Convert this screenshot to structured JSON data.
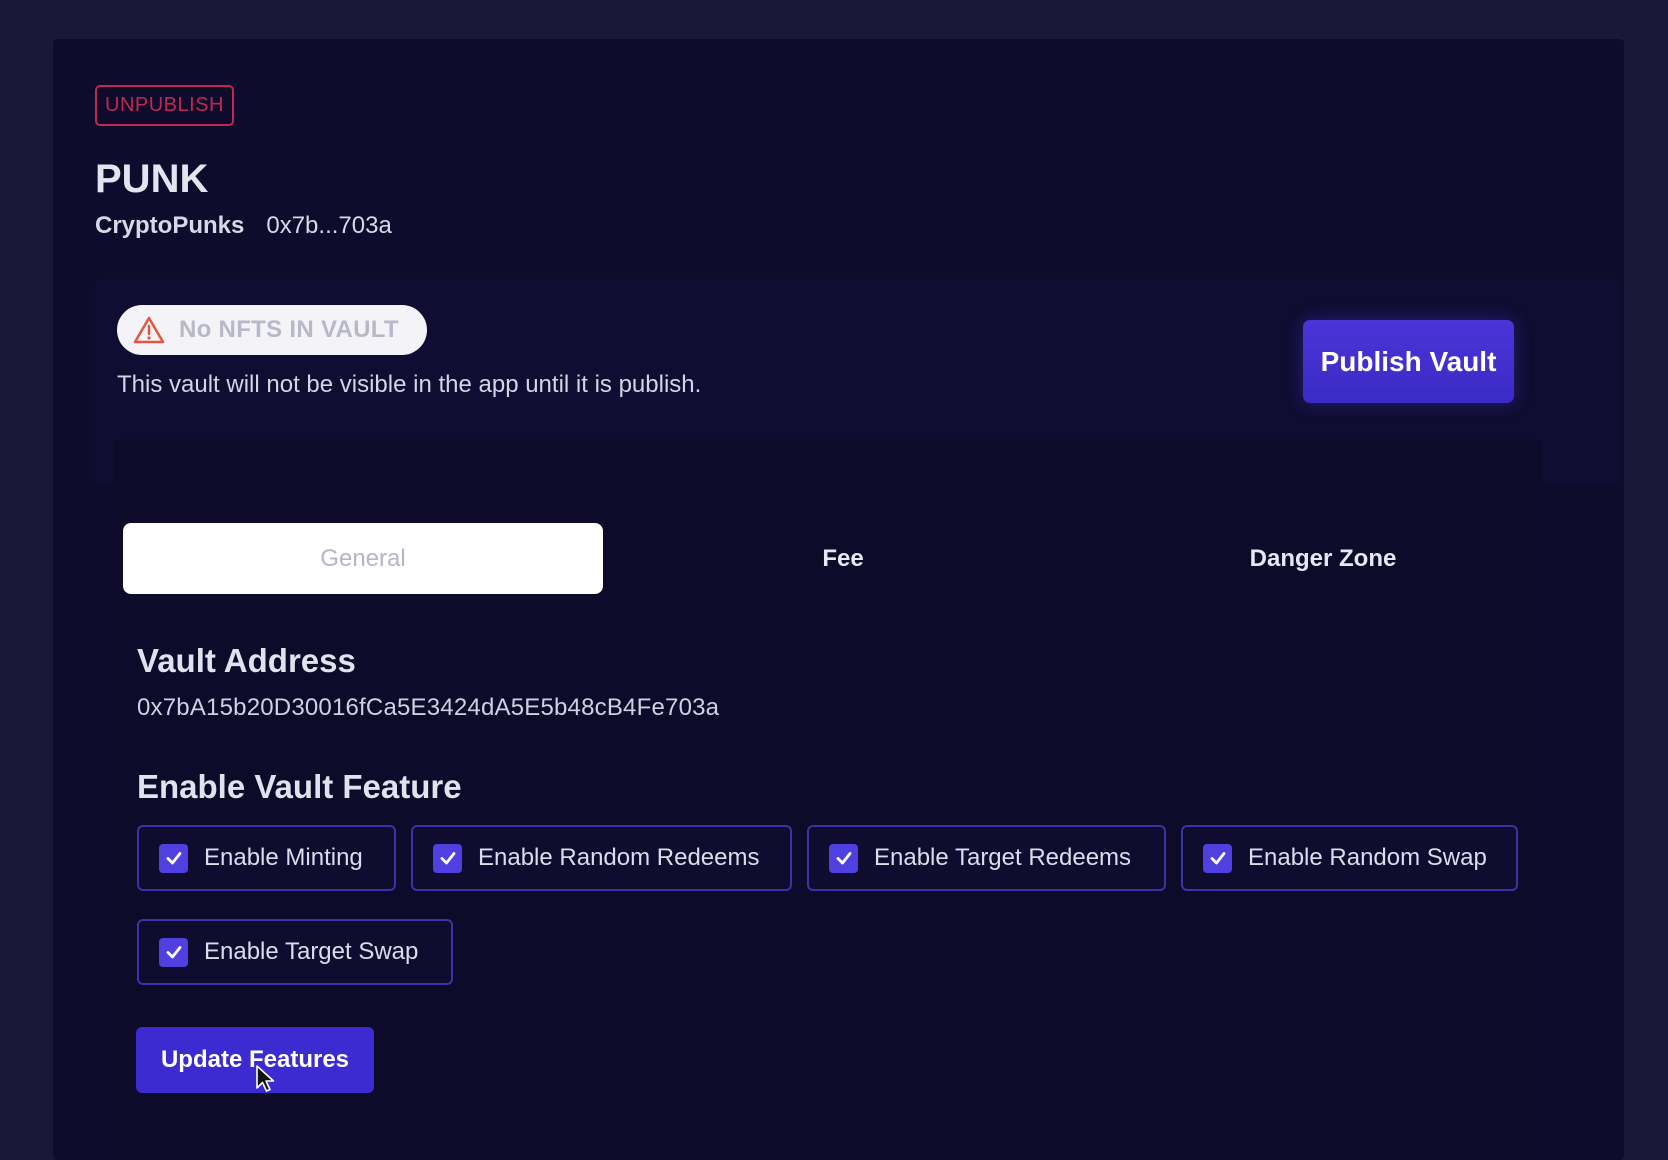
{
  "header": {
    "unpublish_label": "UNPUBLISH",
    "vault_symbol": "PUNK",
    "collection_name": "CryptoPunks",
    "short_address": "0x7b...703a"
  },
  "notice": {
    "badge_icon": "warning-triangle-icon",
    "badge_label": "No NFTS IN VAULT",
    "message": "This vault will not be visible in the app until it is publish.",
    "publish_label": "Publish Vault"
  },
  "tabs": [
    {
      "label": "General",
      "active": true
    },
    {
      "label": "Fee",
      "active": false
    },
    {
      "label": "Danger Zone",
      "active": false
    }
  ],
  "general": {
    "address_title": "Vault Address",
    "address_value": "0x7bA15b20D30016fCa5E3424dA5E5b48cB4Fe703a",
    "features_title": "Enable Vault Feature",
    "features": [
      {
        "label": "Enable Minting",
        "checked": true
      },
      {
        "label": "Enable Random Redeems",
        "checked": true
      },
      {
        "label": "Enable Target Redeems",
        "checked": true
      },
      {
        "label": "Enable Random Swap",
        "checked": true
      },
      {
        "label": "Enable Target Swap",
        "checked": true
      }
    ],
    "update_label": "Update Features"
  },
  "colors": {
    "accent": "#3b2bd0",
    "danger": "#c0284f",
    "background": "#0e0b2c"
  }
}
